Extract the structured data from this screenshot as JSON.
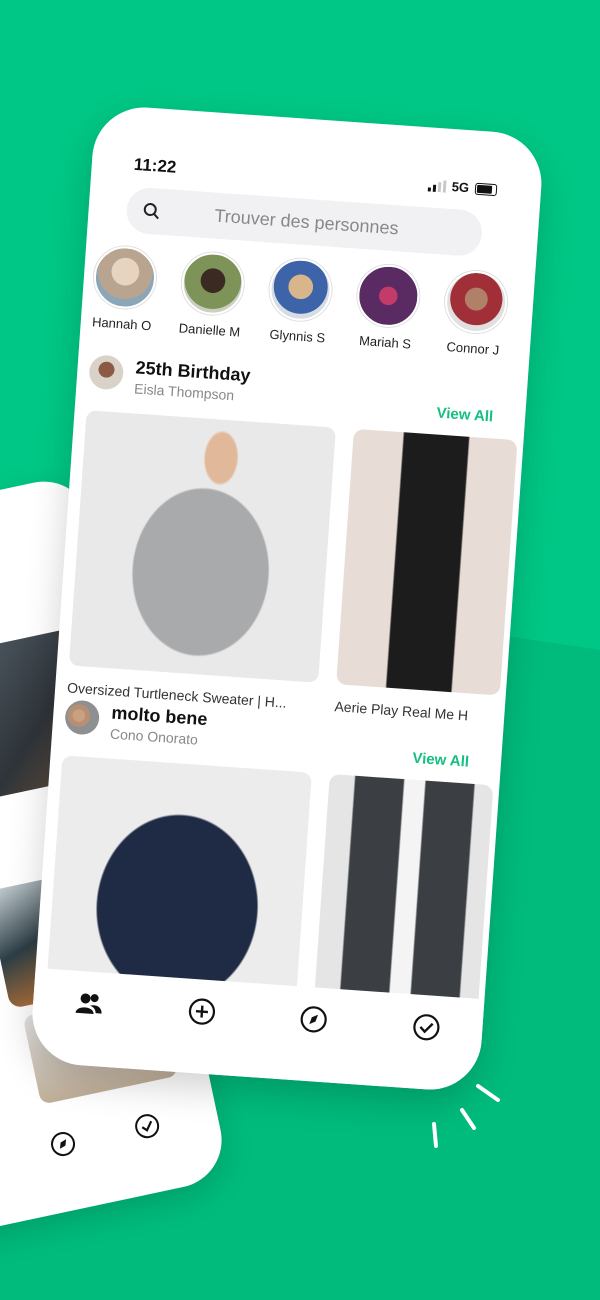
{
  "status_bar": {
    "time": "11:22",
    "network": "5G"
  },
  "search": {
    "placeholder": "Trouver des personnes"
  },
  "people": [
    {
      "name": "Hannah O",
      "avatar_color": "#cfc2b4"
    },
    {
      "name": "Danielle M",
      "avatar_color": "#6a7e4d"
    },
    {
      "name": "Glynnis S",
      "avatar_color": "#9eb1c7"
    },
    {
      "name": "Mariah S",
      "avatar_color": "#5a2a63"
    },
    {
      "name": "Connor J",
      "avatar_color": "#d6d6d6"
    }
  ],
  "sections": [
    {
      "title": "25th Birthday",
      "owner": "Eisla Thompson",
      "view_all": "View All",
      "items": [
        {
          "caption": "Oversized Turtleneck Sweater | H..."
        },
        {
          "caption": "Aerie Play Real Me H"
        }
      ]
    },
    {
      "title": "molto bene",
      "owner": "Cono Onorato",
      "view_all": "View All",
      "items": [
        {
          "caption": ""
        },
        {
          "caption": ""
        }
      ]
    }
  ],
  "tabs": [
    "people-icon",
    "add-icon",
    "compass-icon",
    "check-icon"
  ],
  "colors": {
    "accent": "#13c07f",
    "background": "#00c785"
  }
}
